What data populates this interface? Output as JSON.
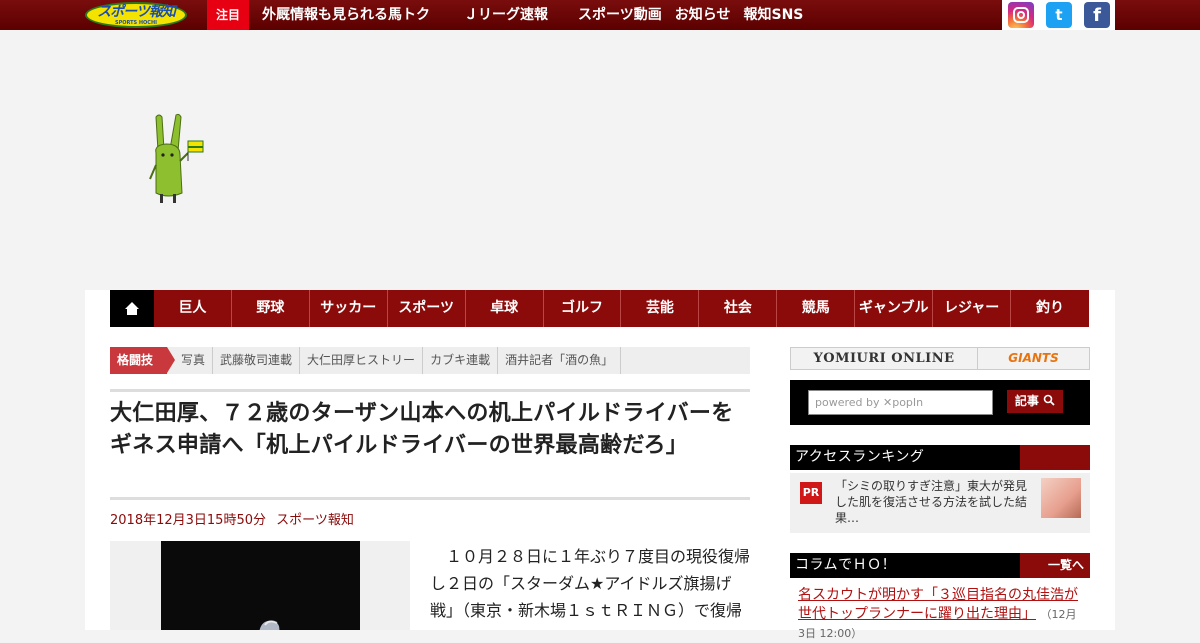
{
  "brand": {
    "logo_text": "スポーツ報知",
    "logo_sub": "SPORTS HOCHI"
  },
  "topnav": {
    "hot_label": "注目",
    "items": [
      "外厩情報も見られる馬トク",
      "Ｊリーグ速報",
      "スポーツ動画",
      "お知らせ",
      "報知SNS"
    ]
  },
  "social": {
    "instagram_icon": "instagram-icon",
    "twitter_icon": "twitter-icon",
    "facebook_icon": "facebook-icon",
    "twitter_glyph": "t",
    "facebook_glyph": "f"
  },
  "catnav": {
    "home_icon": "home-icon",
    "items": [
      "巨人",
      "野球",
      "サッカー",
      "スポーツ",
      "卓球",
      "ゴルフ",
      "芸能",
      "社会",
      "競馬",
      "ギャンブル",
      "レジャー",
      "釣り"
    ]
  },
  "tags": {
    "main": "格闘技",
    "items": [
      "写真",
      "武藤敬司連載",
      "大仁田厚ヒストリー",
      "カブキ連載",
      "酒井記者「酒の魚」"
    ]
  },
  "article": {
    "title": "大仁田厚、７２歳のターザン山本への机上パイルドライバーをギネス申請へ「机上パイルドライバーの世界最高齢だろ」",
    "date": "2018年12月3日15時50分",
    "source": "スポーツ報知",
    "body": "　１０月２８日に１年ぶり７度目の現役復帰し２日の「スターダム★アイドルズ旗揚げ戦」（東京・新木場１ｓｔＲＩＮＧ）で復帰"
  },
  "sidebar": {
    "banner_left": "YOMIURI ONLINE",
    "banner_right": "GIANTS",
    "search_placeholder": "powered by ✕popIn",
    "search_button": "記事",
    "ranking_title": "アクセスランキング",
    "pr_badge": "PR",
    "pr_text": "「シミの取りすぎ注意」東大が発見した肌を復活させる方法を試した結果…",
    "column_title": "コラムでＨＯ！",
    "column_more": "一覧へ",
    "column_link": "名スカウトが明かす「３巡目指名の丸佳浩が世代トップランナーに躍り出た理由」",
    "column_date": "（12月3日 12:00）"
  },
  "colors": {
    "brand_dark_red": "#8b0a0a",
    "hot_red": "#e60012",
    "accent_green": "#8dbf2e"
  }
}
